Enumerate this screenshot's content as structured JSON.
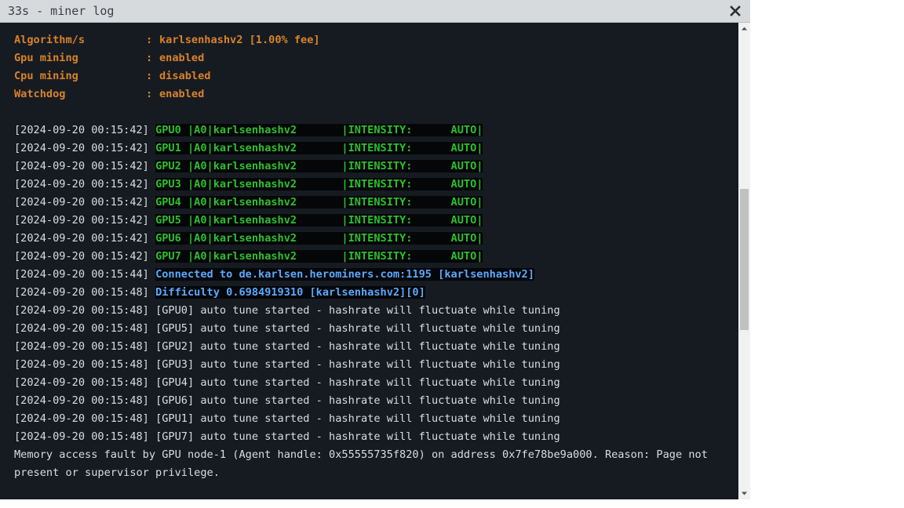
{
  "window": {
    "title": "33s - miner log"
  },
  "config": [
    {
      "key": "Algorithm/s",
      "sep": ":",
      "value": "karlsenhashv2 [1.00% fee]"
    },
    {
      "key": "Gpu mining",
      "sep": ":",
      "value": "enabled"
    },
    {
      "key": "Cpu mining",
      "sep": ":",
      "value": "disabled"
    },
    {
      "key": "Watchdog",
      "sep": ":",
      "value": "enabled"
    }
  ],
  "gpu_lines": [
    {
      "ts": "[2024-09-20 00:15:42]",
      "msg": "GPU0 |A0|karlsenhashv2       |INTENSITY:      AUTO|"
    },
    {
      "ts": "[2024-09-20 00:15:42]",
      "msg": "GPU1 |A0|karlsenhashv2       |INTENSITY:      AUTO|"
    },
    {
      "ts": "[2024-09-20 00:15:42]",
      "msg": "GPU2 |A0|karlsenhashv2       |INTENSITY:      AUTO|"
    },
    {
      "ts": "[2024-09-20 00:15:42]",
      "msg": "GPU3 |A0|karlsenhashv2       |INTENSITY:      AUTO|"
    },
    {
      "ts": "[2024-09-20 00:15:42]",
      "msg": "GPU4 |A0|karlsenhashv2       |INTENSITY:      AUTO|"
    },
    {
      "ts": "[2024-09-20 00:15:42]",
      "msg": "GPU5 |A0|karlsenhashv2       |INTENSITY:      AUTO|"
    },
    {
      "ts": "[2024-09-20 00:15:42]",
      "msg": "GPU6 |A0|karlsenhashv2       |INTENSITY:      AUTO|"
    },
    {
      "ts": "[2024-09-20 00:15:42]",
      "msg": "GPU7 |A0|karlsenhashv2       |INTENSITY:      AUTO|"
    }
  ],
  "network_lines": [
    {
      "ts": "[2024-09-20 00:15:44]",
      "msg": "Connected to de.karlsen.herominers.com:1195 [karlsenhashv2]"
    },
    {
      "ts": "[2024-09-20 00:15:48]",
      "msg": "Difficulty 0.6984919310 [karlsenhashv2][0]"
    }
  ],
  "tune_lines": [
    {
      "ts": "[2024-09-20 00:15:48]",
      "msg": "[GPU0] auto tune started - hashrate will fluctuate while tuning"
    },
    {
      "ts": "[2024-09-20 00:15:48]",
      "msg": "[GPU5] auto tune started - hashrate will fluctuate while tuning"
    },
    {
      "ts": "[2024-09-20 00:15:48]",
      "msg": "[GPU2] auto tune started - hashrate will fluctuate while tuning"
    },
    {
      "ts": "[2024-09-20 00:15:48]",
      "msg": "[GPU3] auto tune started - hashrate will fluctuate while tuning"
    },
    {
      "ts": "[2024-09-20 00:15:48]",
      "msg": "[GPU4] auto tune started - hashrate will fluctuate while tuning"
    },
    {
      "ts": "[2024-09-20 00:15:48]",
      "msg": "[GPU6] auto tune started - hashrate will fluctuate while tuning"
    },
    {
      "ts": "[2024-09-20 00:15:48]",
      "msg": "[GPU1] auto tune started - hashrate will fluctuate while tuning"
    },
    {
      "ts": "[2024-09-20 00:15:48]",
      "msg": "[GPU7] auto tune started - hashrate will fluctuate while tuning"
    }
  ],
  "fault_message": "Memory access fault by GPU node-1 (Agent handle: 0x55555735f820) on address 0x7fe78be9a000. Reason: Page not present or supervisor privilege.",
  "icons": {
    "close": "close-icon",
    "scroll_up": "scroll-up-arrow-icon",
    "scroll_down": "scroll-down-arrow-icon"
  },
  "colors": {
    "background": "#161b22",
    "header": "#d9822b",
    "gpu": "#2bc12b",
    "network": "#5aa9ff",
    "text": "#d9dde2"
  }
}
